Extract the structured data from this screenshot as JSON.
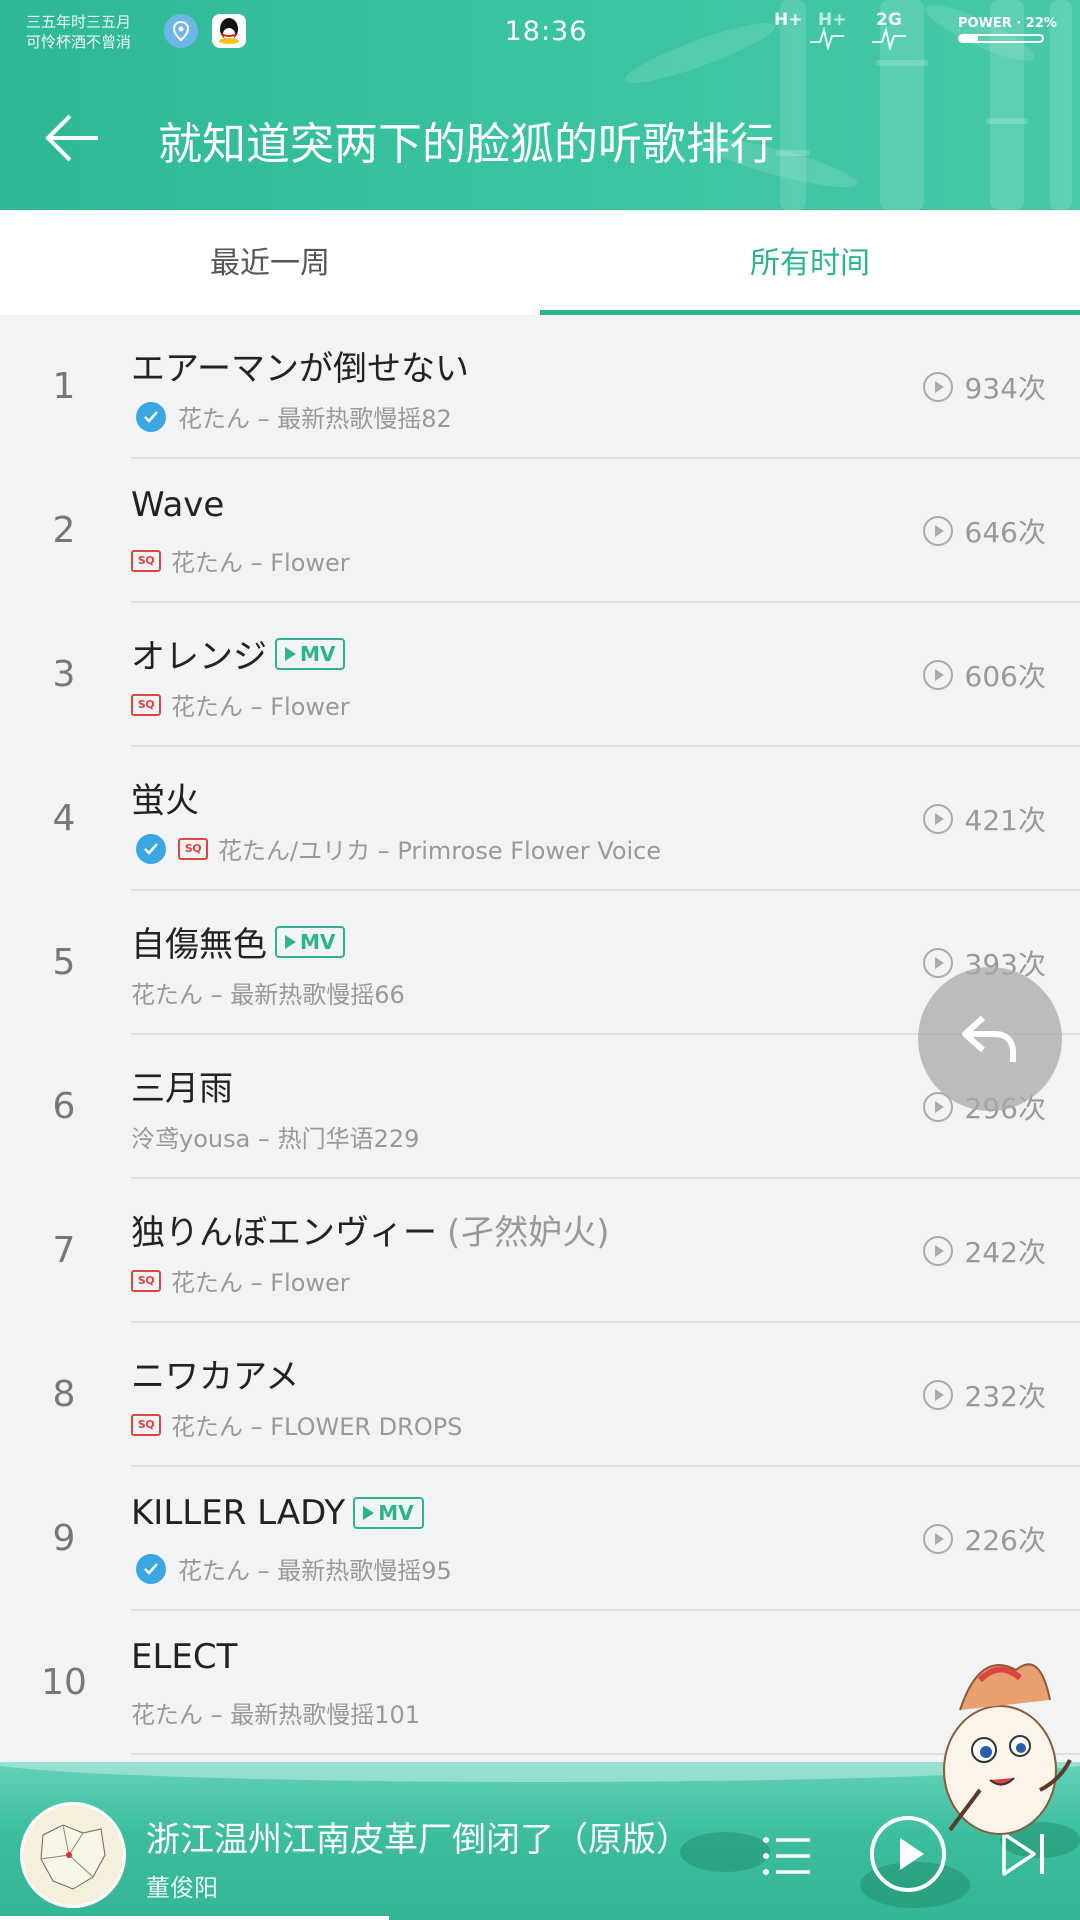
{
  "status_bar": {
    "carrier_line1": "三五年时三五月",
    "carrier_line2": "可怜杯酒不曾消",
    "time": "18:36",
    "network1": "H+",
    "network2": "H+",
    "network3": "2G",
    "battery_label": "POWER · 22%",
    "battery_level": 0.22
  },
  "header": {
    "title": "就知道突两下的脸狐的听歌排行",
    "back_icon": "arrow-left-icon"
  },
  "tabs": [
    {
      "label": "最近一周",
      "active": false
    },
    {
      "label": "所有时间",
      "active": true
    }
  ],
  "songs": [
    {
      "rank": "1",
      "title": "エアーマンが倒せない",
      "subtitle": "",
      "mv": false,
      "badges": [
        "check"
      ],
      "meta": "花たん – 最新热歌慢摇82",
      "count": "934次"
    },
    {
      "rank": "2",
      "title": "Wave",
      "subtitle": "",
      "mv": false,
      "badges": [
        "sq"
      ],
      "meta": "花たん – Flower",
      "count": "646次"
    },
    {
      "rank": "3",
      "title": "オレンジ",
      "subtitle": "",
      "mv": true,
      "badges": [
        "sq"
      ],
      "meta": "花たん – Flower",
      "count": "606次"
    },
    {
      "rank": "4",
      "title": "蛍火",
      "subtitle": "",
      "mv": false,
      "badges": [
        "check",
        "sq"
      ],
      "meta": "花たん/ユリカ – Primrose Flower Voice",
      "count": "421次"
    },
    {
      "rank": "5",
      "title": "自傷無色",
      "subtitle": "",
      "mv": true,
      "badges": [],
      "meta": "花たん – 最新热歌慢摇66",
      "count": "393次"
    },
    {
      "rank": "6",
      "title": "三月雨",
      "subtitle": "",
      "mv": false,
      "badges": [],
      "meta": "泠鸢yousa – 热门华语229",
      "count": "296次"
    },
    {
      "rank": "7",
      "title": "独りんぼエンヴィー",
      "subtitle": "(孑然妒火)",
      "mv": false,
      "badges": [
        "sq"
      ],
      "meta": "花たん – Flower",
      "count": "242次"
    },
    {
      "rank": "8",
      "title": "ニワカアメ",
      "subtitle": "",
      "mv": false,
      "badges": [
        "sq"
      ],
      "meta": "花たん – FLOWER DROPS",
      "count": "232次"
    },
    {
      "rank": "9",
      "title": "KILLER LADY",
      "subtitle": "",
      "mv": true,
      "badges": [
        "check"
      ],
      "meta": "花たん – 最新热歌慢摇95",
      "count": "226次"
    },
    {
      "rank": "10",
      "title": "ELECT",
      "subtitle": "",
      "mv": false,
      "badges": [],
      "meta": "花たん – 最新热歌慢摇101",
      "count": "次"
    }
  ],
  "labels": {
    "mv": "MV",
    "sq": "SQ"
  },
  "player": {
    "title": "浙江温州江南皮革厂倒闭了（原版）",
    "artist": "董俊阳",
    "progress": 0.36,
    "colors": {
      "accent": "#2bb58f",
      "sq": "#e0473a",
      "check": "#3aa8e0"
    }
  }
}
